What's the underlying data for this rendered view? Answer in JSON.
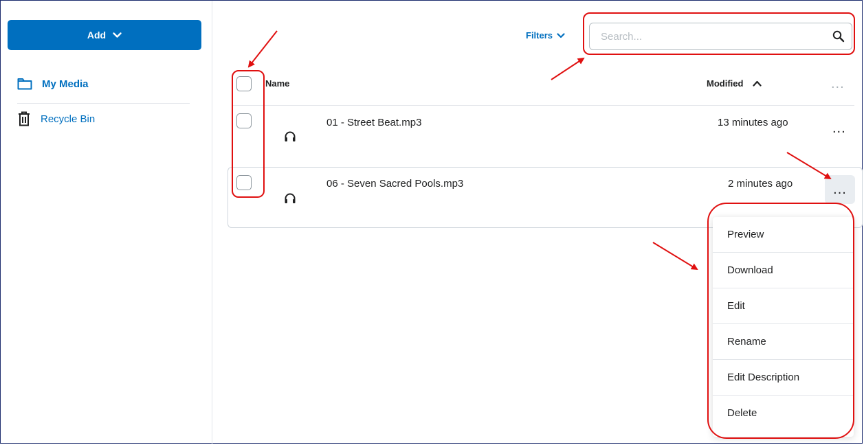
{
  "sidebar": {
    "add_label": "Add",
    "items": [
      {
        "label": "My Media",
        "icon": "folder-icon"
      },
      {
        "label": "Recycle Bin",
        "icon": "trash-icon"
      }
    ]
  },
  "toolbar": {
    "filters_label": "Filters",
    "search_placeholder": "Search..."
  },
  "table": {
    "columns": {
      "name": "Name",
      "modified": "Modified"
    },
    "rows": [
      {
        "name": "01 - Street Beat.mp3",
        "modified": "13 minutes ago",
        "icon": "headphones-icon"
      },
      {
        "name": "06 - Seven Sacred Pools.mp3",
        "modified": "2 minutes ago",
        "icon": "headphones-icon"
      }
    ],
    "more_label": "..."
  },
  "context_menu": {
    "items": [
      "Preview",
      "Download",
      "Edit",
      "Rename",
      "Edit Description",
      "Delete"
    ]
  },
  "colors": {
    "accent": "#006fbf",
    "annotation": "#e01010"
  }
}
